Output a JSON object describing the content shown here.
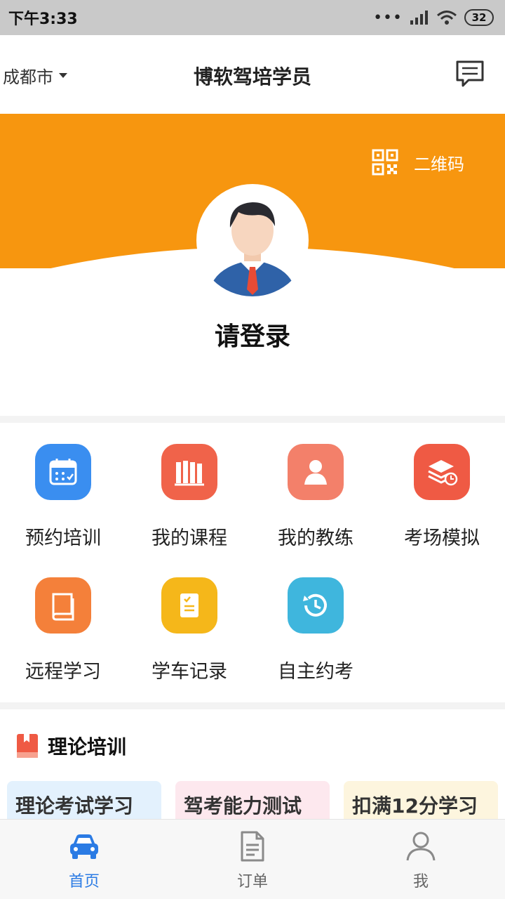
{
  "status_bar": {
    "time": "下午3:33",
    "signal_dots": "•••",
    "battery": "32"
  },
  "header": {
    "city": "成都市",
    "title": "博软驾培学员",
    "message_icon": "message-icon"
  },
  "banner": {
    "qr_label": "二维码",
    "login_prompt": "请登录",
    "accent_color": "#f7960f"
  },
  "menu": {
    "items": [
      {
        "label": "预约培训",
        "icon": "calendar-icon",
        "color": "#3a8ef0"
      },
      {
        "label": "我的课程",
        "icon": "books-icon",
        "color": "#f0634a"
      },
      {
        "label": "我的教练",
        "icon": "person-icon",
        "color": "#f3806a"
      },
      {
        "label": "考场模拟",
        "icon": "layers-clock-icon",
        "color": "#ef5a44"
      },
      {
        "label": "远程学习",
        "icon": "book-icon",
        "color": "#f4803a"
      },
      {
        "label": "学车记录",
        "icon": "clipboard-icon",
        "color": "#f5b71a"
      },
      {
        "label": "自主约考",
        "icon": "history-icon",
        "color": "#3fb6dd"
      }
    ]
  },
  "theory": {
    "title": "理论培训",
    "cards": [
      {
        "label": "理论考试学习",
        "bg": "#e3f1fd"
      },
      {
        "label": "驾考能力测试",
        "bg": "#fde8ee"
      },
      {
        "label": "扣满12分学习",
        "bg": "#fdf5de"
      }
    ]
  },
  "tabbar": {
    "tabs": [
      {
        "label": "首页",
        "icon": "car-icon",
        "active": true
      },
      {
        "label": "订单",
        "icon": "document-icon",
        "active": false
      },
      {
        "label": "我",
        "icon": "user-icon",
        "active": false
      }
    ],
    "active_color": "#2b7be4"
  }
}
